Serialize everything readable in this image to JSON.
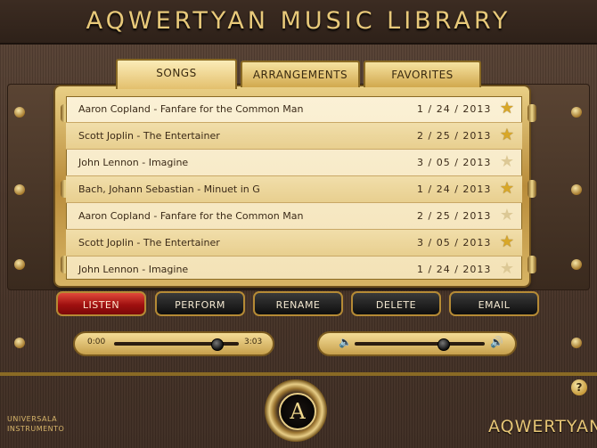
{
  "app": {
    "title": "AQWERTYAN MUSIC LIBRARY"
  },
  "tabs": [
    {
      "label": "SONGS",
      "active": true
    },
    {
      "label": "ARRANGEMENTS",
      "active": false
    },
    {
      "label": "FAVORITES",
      "active": false
    }
  ],
  "songs": [
    {
      "title": "Aaron Copland - Fanfare for the Common Man",
      "date": "1 / 24 / 2013",
      "favorite": true
    },
    {
      "title": "Scott Joplin - The Entertainer",
      "date": "2 / 25 / 2013",
      "favorite": true
    },
    {
      "title": "John Lennon - Imagine",
      "date": "3 / 05 / 2013",
      "favorite": false
    },
    {
      "title": "Bach, Johann Sebastian - Minuet in G",
      "date": "1 / 24 / 2013",
      "favorite": true
    },
    {
      "title": "Aaron Copland - Fanfare for the Common Man",
      "date": "2 / 25 / 2013",
      "favorite": false
    },
    {
      "title": "Scott Joplin - The Entertainer",
      "date": "3 / 05 / 2013",
      "favorite": true
    },
    {
      "title": "John Lennon - Imagine",
      "date": "1 / 24 / 2013",
      "favorite": false
    }
  ],
  "actions": {
    "listen": "LISTEN",
    "perform": "PERFORM",
    "rename": "RENAME",
    "delete": "DELETE",
    "email": "EMAIL"
  },
  "playback": {
    "current_time": "0:00",
    "total_time": "3:03",
    "progress": 0.82
  },
  "volume": {
    "level": 0.68
  },
  "brand": {
    "left_line1": "UNIVERSALA",
    "left_line2": "INSTRUMENTO",
    "right": "AQWERTYAN",
    "medal_letter": "A",
    "help": "?"
  },
  "colors": {
    "accent_gold": "#e8c97a",
    "active_button": "#c0201a",
    "star": "#d8a728"
  }
}
